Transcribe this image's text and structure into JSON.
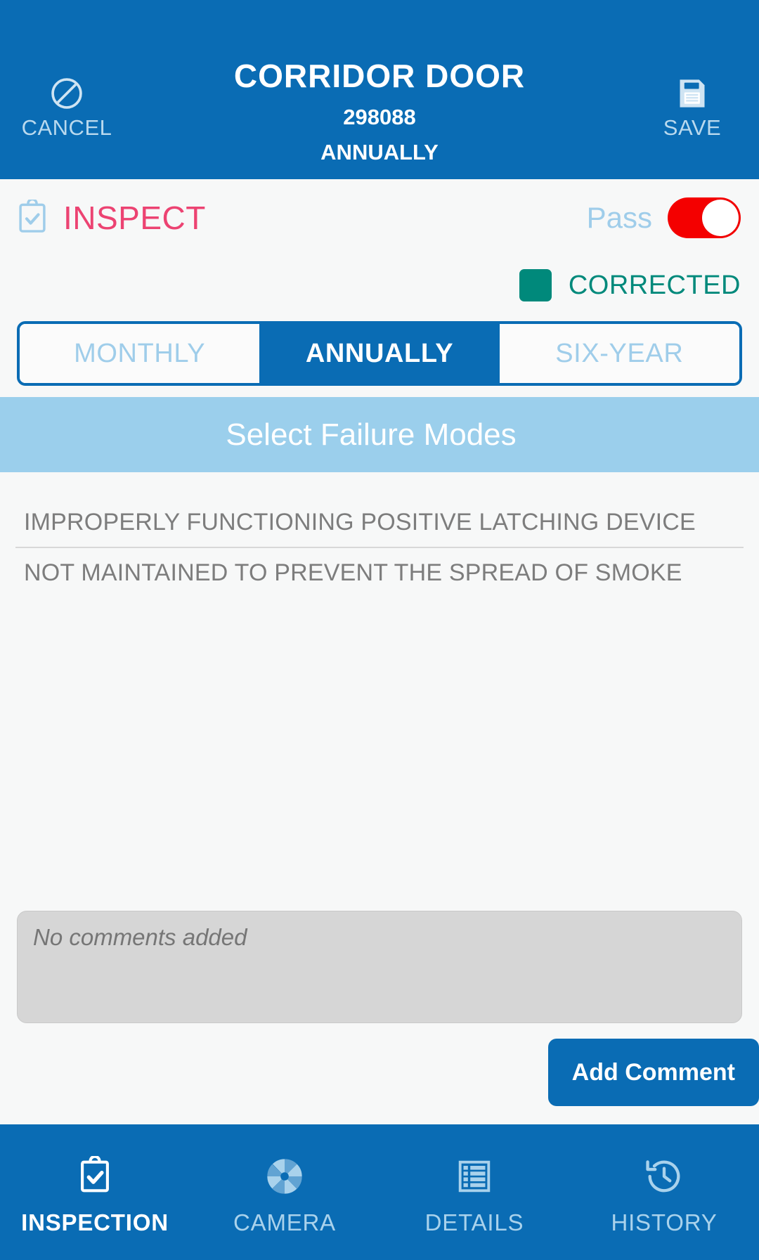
{
  "appbar": {
    "cancel": {
      "label": "CANCEL",
      "icon": "block-circle-icon"
    },
    "save": {
      "label": "SAVE",
      "icon": "floppy-disk-save-icon"
    },
    "title": "CORRIDOR DOOR",
    "asset_id": "298088",
    "frequency": "ANNUALLY",
    "background_color": "#0A6CB4"
  },
  "inspect": {
    "icon": "clipboard-check-icon",
    "label": "INSPECT",
    "label_color": "#EC4372",
    "toggle_label": "Pass",
    "toggle_state": "off",
    "toggle_color": "#F40000"
  },
  "corrected": {
    "label": "CORRECTED",
    "checked": true,
    "color": "#00897B"
  },
  "segmented": {
    "options": [
      {
        "label": "MONTHLY",
        "active": false
      },
      {
        "label": "ANNUALLY",
        "active": true
      },
      {
        "label": "SIX-YEAR",
        "active": false
      }
    ],
    "active_color": "#0A6CB4",
    "inactive_text_color": "#9FCDEA"
  },
  "failure_modes": {
    "header": "Select Failure Modes",
    "header_bg": "#9BCFEC",
    "items": [
      "IMPROPERLY FUNCTIONING POSITIVE LATCHING DEVICE",
      "NOT MAINTAINED TO PREVENT THE SPREAD OF SMOKE"
    ]
  },
  "comments": {
    "placeholder": "No comments added",
    "value": "",
    "add_button": "Add Comment"
  },
  "bottomnav": {
    "items": [
      {
        "label": "INSPECTION",
        "icon": "clipboard-check-icon",
        "active": true
      },
      {
        "label": "CAMERA",
        "icon": "camera-aperture-icon",
        "active": false
      },
      {
        "label": "DETAILS",
        "icon": "list-table-icon",
        "active": false
      },
      {
        "label": "HISTORY",
        "icon": "clock-history-icon",
        "active": false
      }
    ]
  }
}
